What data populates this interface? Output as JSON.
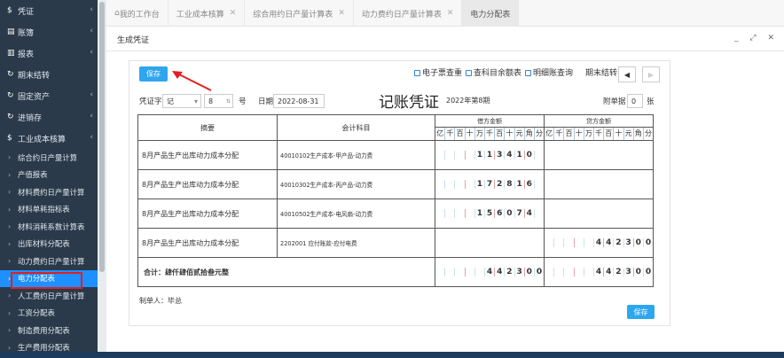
{
  "sidebar": {
    "items": [
      {
        "label": "凭证",
        "icon": "dollar-icon",
        "y": 0
      },
      {
        "label": "账簿",
        "icon": "book-icon"
      },
      {
        "label": "报表",
        "icon": "report-icon"
      },
      {
        "label": "期末结转",
        "icon": "refresh-icon"
      },
      {
        "label": "固定资产",
        "icon": "asset-icon"
      },
      {
        "label": "进销存",
        "icon": "refresh-icon"
      },
      {
        "label": "工业成本核算",
        "icon": "dollar-icon"
      }
    ],
    "subitems": [
      "综合约日产量计算",
      "产值报表",
      "材料费约日产量计算",
      "材料单耗指标表",
      "材料消耗系数计算表",
      "出库材料分配表",
      "动力费约日产量计算",
      "电力分配表",
      "人工费约日产量计算",
      "工资分配表",
      "制造费用分配表",
      "生产费用分配表"
    ],
    "active": "电力分配表"
  },
  "tabs": [
    {
      "label": "我的工作台",
      "closable": false
    },
    {
      "label": "工业成本核算",
      "closable": true
    },
    {
      "label": "综合用约日产量计算表",
      "closable": true
    },
    {
      "label": "动力费约日产量计算表",
      "closable": true
    },
    {
      "label": "电力分配表",
      "closable": false,
      "active": true
    }
  ],
  "dialog": {
    "title": "生成凭证",
    "controls": "_ ⤢ ✕"
  },
  "toolbar": {
    "save_label": "保存",
    "links": [
      "电子票查重",
      "查科目余额表",
      "明细账查询"
    ],
    "period_close": "期末结转",
    "prev": "◀",
    "next": "▶"
  },
  "voucher": {
    "word_label": "凭证字",
    "word_value": "记",
    "number_value": "8",
    "number_label": "号",
    "date_label": "日期",
    "date_value": "2022-08-31",
    "title": "记账凭证",
    "period": "2022年第8期",
    "attach_label": "附单据",
    "attach_value": "0",
    "attach_unit": "张"
  },
  "table": {
    "headers": {
      "summary": "摘要",
      "account": "会计科目",
      "debit": "借方金额",
      "credit": "贷方金额"
    },
    "digit_units": [
      "亿",
      "千",
      "百",
      "十",
      "万",
      "千",
      "百",
      "十",
      "元",
      "角",
      "分"
    ],
    "rows": [
      {
        "summary": "8月产品生产出库动力成本分配",
        "account": "40010102生产成本-甲产品-动力费",
        "debit": [
          "",
          "",
          "",
          "",
          "1",
          "1",
          "3",
          "4",
          "1",
          "0",
          ""
        ],
        "credit": [
          "",
          "",
          "",
          "",
          "",
          "",
          "",
          "",
          "",
          "",
          ""
        ]
      },
      {
        "summary": "8月产品生产出库动力成本分配",
        "account": "40010302生产成本-丙产品-动力费",
        "debit": [
          "",
          "",
          "",
          "",
          "1",
          "7",
          "2",
          "8",
          "1",
          "6",
          ""
        ],
        "credit": [
          "",
          "",
          "",
          "",
          "",
          "",
          "",
          "",
          "",
          "",
          ""
        ]
      },
      {
        "summary": "8月产品生产出库动力成本分配",
        "account": "40010502生产成本-电风扇-动力费",
        "debit": [
          "",
          "",
          "",
          "",
          "1",
          "5",
          "6",
          "0",
          "7",
          "4",
          ""
        ],
        "credit": [
          "",
          "",
          "",
          "",
          "",
          "",
          "",
          "",
          "",
          "",
          ""
        ]
      },
      {
        "summary": "8月产品生产出库动力成本分配",
        "account": "2202001 应付账款-应付电费",
        "debit": [
          "",
          "",
          "",
          "",
          "",
          "",
          "",
          "",
          "",
          "",
          ""
        ],
        "credit": [
          "",
          "",
          "",
          "",
          "",
          "4",
          "4",
          "2",
          "3",
          "0",
          "0"
        ]
      }
    ],
    "total": {
      "label": "合计：肆仟肆佰贰拾叁元整",
      "debit": [
        "",
        "",
        "",
        "",
        "",
        "4",
        "4",
        "2",
        "3",
        "0",
        "0"
      ],
      "credit": [
        "",
        "",
        "",
        "",
        "",
        "4",
        "4",
        "2",
        "3",
        "0",
        "0"
      ]
    }
  },
  "preparer": "制单人：毕总",
  "bottom_save": "保存"
}
